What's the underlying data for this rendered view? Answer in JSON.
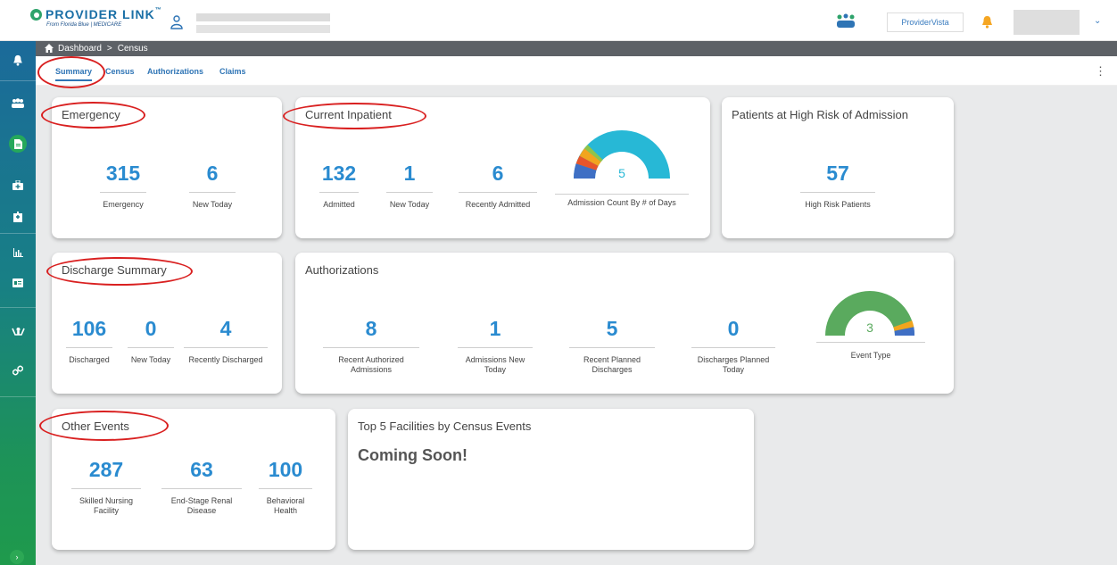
{
  "header": {
    "logo_text": "PROVIDER LINK",
    "logo_tm": "™",
    "logo_sub": "From Florida Blue | MEDICARE",
    "providervista_label": "ProviderVista",
    "icons": [
      "user-icon",
      "people-icon",
      "bell-icon",
      "chevron-down-icon"
    ]
  },
  "sidebar": {
    "items": [
      "bell-icon",
      "users-icon",
      "document-icon",
      "medical-bag-icon",
      "building-icon",
      "chart-icon",
      "id-card-icon",
      "hands-icon",
      "link-icon"
    ],
    "expand_label": "›"
  },
  "breadcrumb": {
    "home": "Dashboard",
    "sep": ">",
    "current": "Census"
  },
  "tabs": [
    {
      "label": "Summary",
      "active": true
    },
    {
      "label": "Census"
    },
    {
      "label": "Authorizations"
    },
    {
      "label": "Claims"
    }
  ],
  "cards": {
    "emergency": {
      "title": "Emergency",
      "stats": [
        {
          "value": "315",
          "label": "Emergency"
        },
        {
          "value": "6",
          "label": "New Today"
        }
      ]
    },
    "current_inpatient": {
      "title": "Current Inpatient",
      "stats": [
        {
          "value": "132",
          "label": "Admitted"
        },
        {
          "value": "1",
          "label": "New Today"
        },
        {
          "value": "6",
          "label": "Recently Admitted"
        }
      ],
      "gauge_value": "5",
      "gauge_label": "Admission Count By # of Days"
    },
    "high_risk": {
      "title": "Patients at High Risk of Admission",
      "stats": [
        {
          "value": "57",
          "label": "High Risk Patients"
        }
      ]
    },
    "discharge": {
      "title": "Discharge Summary",
      "stats": [
        {
          "value": "106",
          "label": "Discharged"
        },
        {
          "value": "0",
          "label": "New Today"
        },
        {
          "value": "4",
          "label": "Recently Discharged"
        }
      ]
    },
    "authorizations": {
      "title": "Authorizations",
      "stats": [
        {
          "value": "8",
          "label": "Recent Authorized Admissions"
        },
        {
          "value": "1",
          "label": "Admissions New Today"
        },
        {
          "value": "5",
          "label": "Recent Planned Discharges"
        },
        {
          "value": "0",
          "label": "Discharges Planned Today"
        }
      ],
      "gauge_value": "3",
      "gauge_label": "Event Type"
    },
    "other_events": {
      "title": "Other Events",
      "stats": [
        {
          "value": "287",
          "label": "Skilled Nursing Facility"
        },
        {
          "value": "63",
          "label": "End-Stage Renal Disease"
        },
        {
          "value": "100",
          "label": "Behavioral Health"
        }
      ]
    },
    "top_facilities": {
      "title": "Top 5 Facilities by Census Events",
      "body": "Coming Soon!"
    }
  },
  "colors": {
    "accent": "#2a8bd0",
    "sidebar_top": "#1b6a9a",
    "sidebar_bottom": "#1f9a4c",
    "gauge_inpatient": "#27b8d6",
    "gauge_event": "#5aaa5e",
    "annotation": "#d92020"
  }
}
